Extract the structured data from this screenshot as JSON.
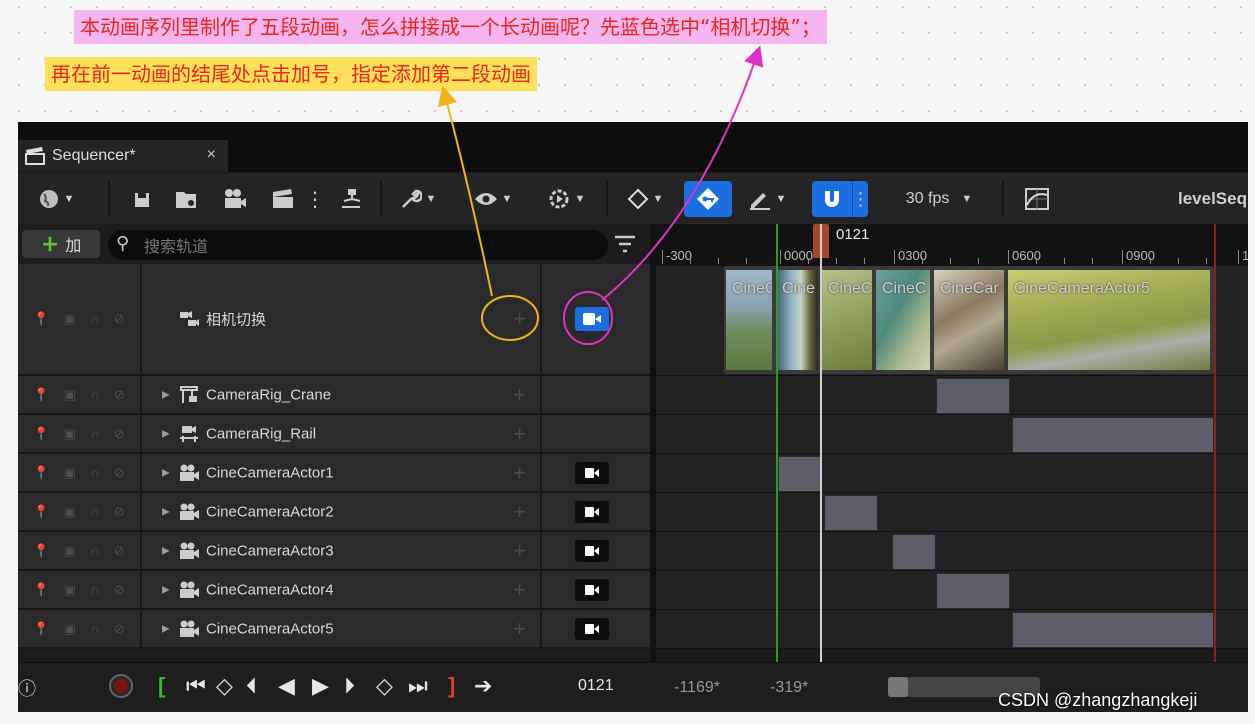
{
  "notes": {
    "line1": "本动画序列里制作了五段动画，怎么拼接成一个长动画呢？先蓝色选中“相机切换”；",
    "line2": "再在前一动画的结尾处点击加号，指定添加第二段动画"
  },
  "tab": {
    "title": "Sequencer*",
    "close": "×"
  },
  "toolbar": {
    "fps": "30 fps",
    "sequence_name": "levelSeq"
  },
  "left": {
    "add_label": "加",
    "search_placeholder": "搜索轨道"
  },
  "tracks": [
    {
      "name": "相机切换",
      "type": "camera-cuts",
      "camera_active": true
    },
    {
      "name": "CameraRig_Crane",
      "type": "crane",
      "camera_toggle": false
    },
    {
      "name": "CameraRig_Rail",
      "type": "rail",
      "camera_toggle": false
    },
    {
      "name": "CineCameraActor1",
      "type": "camera",
      "camera_toggle": true
    },
    {
      "name": "CineCameraActor2",
      "type": "camera",
      "camera_toggle": true
    },
    {
      "name": "CineCameraActor3",
      "type": "camera",
      "camera_toggle": true
    },
    {
      "name": "CineCameraActor4",
      "type": "camera",
      "camera_toggle": true
    },
    {
      "name": "CineCameraActor5",
      "type": "camera",
      "camera_toggle": true
    }
  ],
  "ruler": {
    "labels": [
      "-300",
      "0000",
      "0300",
      "0600",
      "0900",
      "1"
    ],
    "playhead_frame": "0121"
  },
  "shots": [
    "CineC",
    "Cine",
    "CineC",
    "CineC",
    "CineCar",
    "CineCameraActor5"
  ],
  "bottom": {
    "current_frame": "0121",
    "range_start": "-1169*",
    "range_end": "-319*"
  },
  "watermark": "CSDN @zhangzhangkeji",
  "colors": {
    "highlight_yellow": "#f2b21c",
    "highlight_magenta": "#e033c6",
    "selected_blue": "#1b6ee0"
  }
}
